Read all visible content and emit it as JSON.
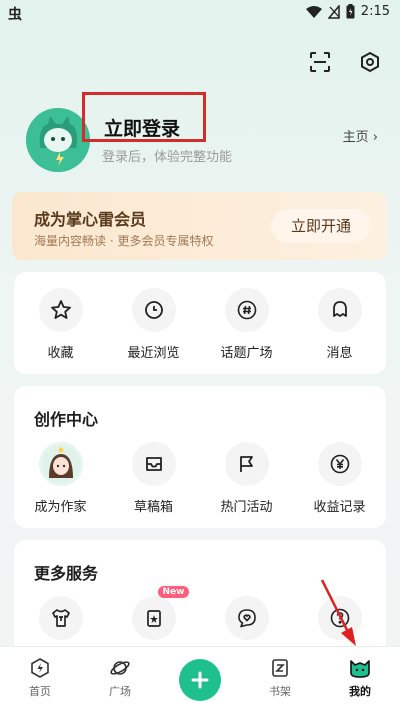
{
  "status_bar": {
    "app_glyph": "虫",
    "time": "2:15"
  },
  "profile": {
    "login_title": "立即登录",
    "login_subtitle": "登录后，体验完整功能",
    "homepage_link": "主页 ›"
  },
  "vip": {
    "title": "成为掌心雷会员",
    "subtitle": "海量内容畅读 · 更多会员专属特权",
    "button": "立即开通"
  },
  "quick_actions": [
    {
      "label": "收藏",
      "icon": "star-icon"
    },
    {
      "label": "最近浏览",
      "icon": "clock-icon"
    },
    {
      "label": "话题广场",
      "icon": "hashtag-icon"
    },
    {
      "label": "消息",
      "icon": "bell-icon"
    }
  ],
  "creation_center": {
    "title": "创作中心",
    "items": [
      {
        "label": "成为作家",
        "icon": "writer-avatar-icon"
      },
      {
        "label": "草稿箱",
        "icon": "inbox-icon"
      },
      {
        "label": "热门活动",
        "icon": "flag-icon"
      },
      {
        "label": "收益记录",
        "icon": "yen-icon"
      }
    ]
  },
  "more_services": {
    "title": "更多服务",
    "badge": "New",
    "items": [
      {
        "icon": "tshirt-icon"
      },
      {
        "icon": "cards-icon"
      },
      {
        "icon": "heart-chat-icon"
      },
      {
        "icon": "question-icon"
      }
    ]
  },
  "bottom_nav": [
    {
      "label": "首页",
      "icon": "lightning-icon"
    },
    {
      "label": "广场",
      "icon": "planet-icon"
    },
    {
      "label": "",
      "icon": "plus-icon"
    },
    {
      "label": "书架",
      "icon": "bookshelf-icon"
    },
    {
      "label": "我的",
      "icon": "cat-face-icon",
      "active": true
    }
  ],
  "colors": {
    "accent": "#1ec18d",
    "highlight_box": "#d62b2b",
    "arrow": "#e02020",
    "vip_text": "#5a3a1d"
  }
}
